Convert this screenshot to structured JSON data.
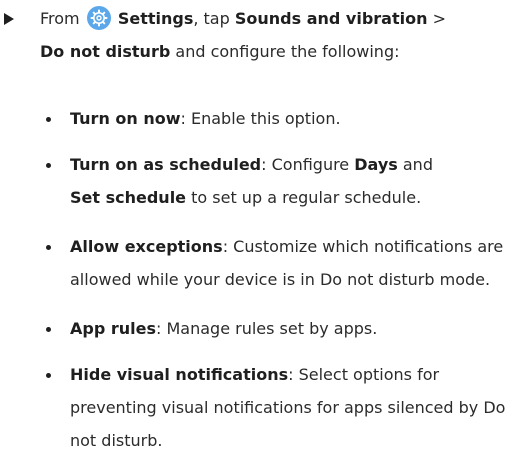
{
  "step": {
    "from": "From",
    "settings": "Settings",
    "tap": ", tap",
    "sounds": "Sounds and vibration",
    "sep": " > ",
    "dnd": "Do not disturb",
    "rest": " and configure the following:"
  },
  "items": [
    {
      "label": "Turn on now",
      "text": ": Enable this option."
    },
    {
      "label": "Turn on as scheduled",
      "text_a": ": Configure ",
      "days": "Days",
      "text_b": " and ",
      "set_schedule": "Set schedule",
      "text_c": " to set up a regular schedule."
    },
    {
      "label": "Allow exceptions",
      "text": ": Customize which notifications are allowed while your device is in Do not disturb mode."
    },
    {
      "label": "App rules",
      "text": ": Manage rules set by apps."
    },
    {
      "label": "Hide visual notifications",
      "text": ": Select options for preventing visual notifications for apps silenced by Do not disturb."
    }
  ],
  "icons": {
    "arrow": "triangle-right",
    "settings": "gear",
    "settings_color": "#5aa8ea"
  }
}
